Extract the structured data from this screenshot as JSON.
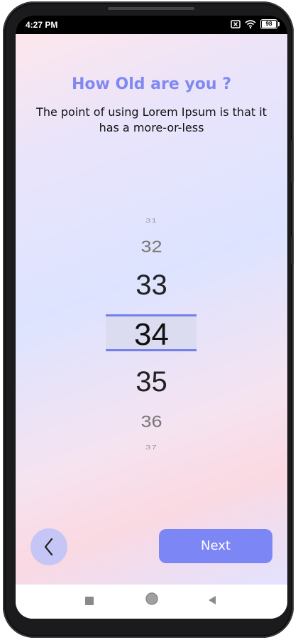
{
  "status_bar": {
    "time": "4:27 PM",
    "battery": "98",
    "icons": [
      "sim-x-icon",
      "wifi-icon",
      "battery-icon"
    ]
  },
  "onboarding": {
    "title": "How Old are you ?",
    "subtitle": "The point of using Lorem Ipsum is that it has a more-or-less"
  },
  "age_picker": {
    "values": [
      "31",
      "32",
      "33",
      "34",
      "35",
      "36",
      "37"
    ],
    "selected": "34"
  },
  "buttons": {
    "back_icon": "chevron-left-icon",
    "next_label": "Next"
  },
  "nav_bar": {
    "icons": [
      "recent-apps-icon",
      "home-icon",
      "back-triangle-icon"
    ]
  },
  "colors": {
    "accent": "#7c86f5",
    "title": "#8088f2",
    "back_button": "#c5c6f5",
    "selection_line": "#7480ea"
  }
}
